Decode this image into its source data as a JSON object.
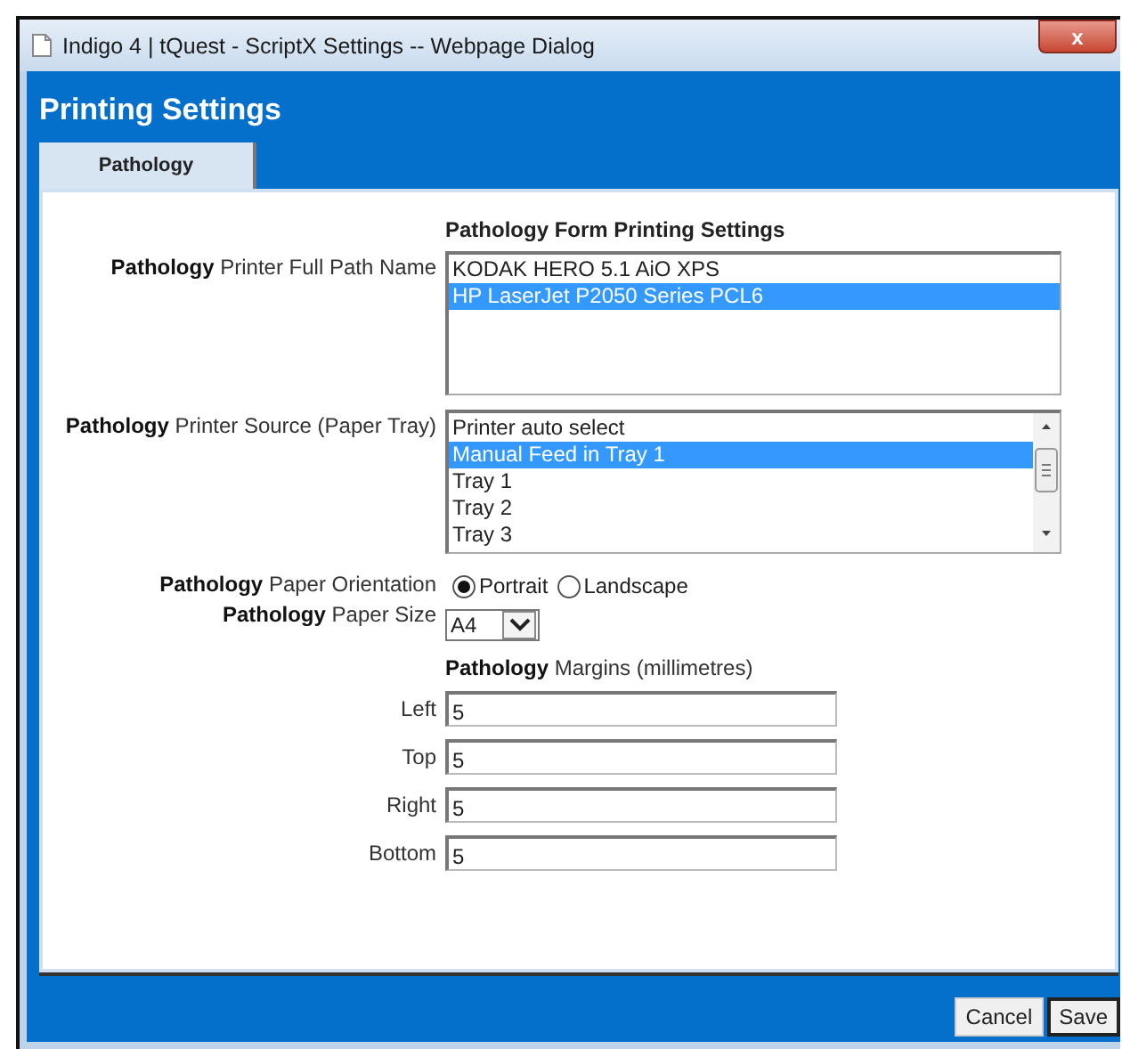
{
  "window": {
    "title": "Indigo 4 | tQuest - ScriptX Settings -- Webpage Dialog",
    "close": "x"
  },
  "heading": "Printing Settings",
  "tabs": [
    {
      "label": "Pathology",
      "selected": true
    }
  ],
  "form": {
    "title": "Pathology Form Printing Settings",
    "printer": {
      "label": "**Pathology** Printer Full Path Name",
      "options": [
        {
          "text": "KODAK HERO 5.1 AiO XPS",
          "selected": false
        },
        {
          "text": "HP LaserJet P2050 Series PCL6",
          "selected": true
        }
      ]
    },
    "source": {
      "label": "**Pathology** Printer Source (Paper Tray)",
      "options": [
        {
          "text": "Printer auto select",
          "selected": false
        },
        {
          "text": "Manual Feed in Tray 1",
          "selected": true
        },
        {
          "text": "Tray 1",
          "selected": false
        },
        {
          "text": "Tray 2",
          "selected": false
        },
        {
          "text": "Tray 3",
          "selected": false
        }
      ]
    },
    "orientation": {
      "label": "**Pathology** Paper Orientation",
      "options": [
        {
          "text": "Portrait",
          "selected": true
        },
        {
          "text": "Landscape",
          "selected": false
        }
      ]
    },
    "paper_size": {
      "label": "**Pathology** Paper Size",
      "value": "A4"
    },
    "margins": {
      "title": "**Pathology** Margins (millimetres)",
      "fields": [
        {
          "label": "Left",
          "value": "5"
        },
        {
          "label": "Top",
          "value": "5"
        },
        {
          "label": "Right",
          "value": "5"
        },
        {
          "label": "Bottom",
          "value": "5"
        }
      ]
    }
  },
  "buttons": [
    "Cancel",
    "Save"
  ]
}
